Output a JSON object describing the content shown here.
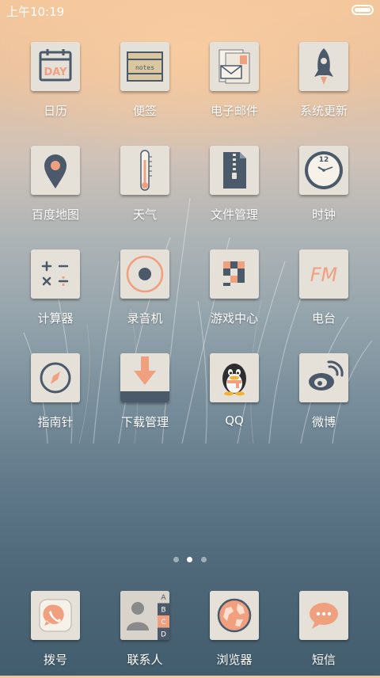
{
  "status_bar": {
    "time": "上午10:19"
  },
  "colors": {
    "accent": "#f0a07f",
    "slate": "#4a5a6a",
    "tile": "#e5e0d8"
  },
  "apps": [
    {
      "label": "日历",
      "icon": "calendar-icon",
      "tile_text": "DAY"
    },
    {
      "label": "便签",
      "icon": "notes-icon",
      "tile_text": "notes"
    },
    {
      "label": "电子邮件",
      "icon": "email-icon"
    },
    {
      "label": "系统更新",
      "icon": "rocket-icon"
    },
    {
      "label": "百度地图",
      "icon": "map-pin-icon"
    },
    {
      "label": "天气",
      "icon": "thermometer-icon"
    },
    {
      "label": "文件管理",
      "icon": "zip-file-icon"
    },
    {
      "label": "时钟",
      "icon": "clock-icon",
      "tile_text": "12"
    },
    {
      "label": "计算器",
      "icon": "calculator-icon"
    },
    {
      "label": "录音机",
      "icon": "record-icon"
    },
    {
      "label": "游戏中心",
      "icon": "game-blocks-icon"
    },
    {
      "label": "电台",
      "icon": "radio-fm-icon",
      "tile_text": "FM"
    },
    {
      "label": "指南针",
      "icon": "compass-icon"
    },
    {
      "label": "下载管理",
      "icon": "download-icon"
    },
    {
      "label": "QQ",
      "icon": "qq-penguin-icon"
    },
    {
      "label": "微博",
      "icon": "weibo-icon"
    }
  ],
  "page_indicator": {
    "pages": 3,
    "current": 2
  },
  "dock": [
    {
      "label": "拨号",
      "icon": "phone-icon"
    },
    {
      "label": "联系人",
      "icon": "contacts-icon",
      "tabs": [
        "A",
        "B",
        "C",
        "D"
      ]
    },
    {
      "label": "浏览器",
      "icon": "globe-icon"
    },
    {
      "label": "短信",
      "icon": "message-icon"
    }
  ]
}
